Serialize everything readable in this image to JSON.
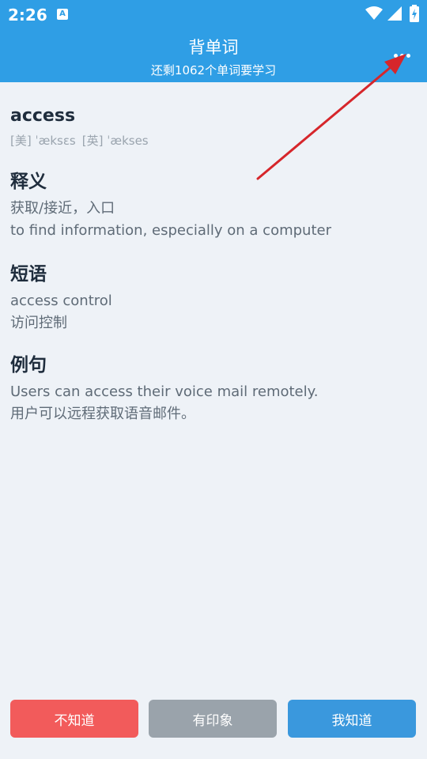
{
  "status_bar": {
    "time": "2:26",
    "app_icon": "A"
  },
  "header": {
    "title": "背单词",
    "subtitle": "还剩1062个单词要学习",
    "background": "#2f9ee5"
  },
  "word": {
    "text": "access",
    "phonetic_us": "[美] ˈæksɛs",
    "phonetic_uk": "[英] ˈækses"
  },
  "definition": {
    "title": "释义",
    "lines": [
      "获取/接近，入口",
      "to find information, especially on a computer"
    ]
  },
  "phrase": {
    "title": "短语",
    "lines": [
      "access control",
      "访问控制"
    ]
  },
  "example": {
    "title": "例句",
    "lines": [
      "Users can access their voice mail remotely.",
      "用户可以远程获取语音邮件。"
    ]
  },
  "buttons": {
    "unknown": "不知道",
    "vague": "有印象",
    "known": "我知道"
  },
  "colors": {
    "accent": "#2f9ee5",
    "unknown": "#f25b5b",
    "vague": "#9aa3ab",
    "known": "#3a98dd",
    "annotation_arrow": "#d6262b"
  },
  "icons": {
    "more": "more-dots-icon",
    "wifi": "wifi-icon",
    "signal": "signal-icon",
    "battery": "battery-icon"
  }
}
